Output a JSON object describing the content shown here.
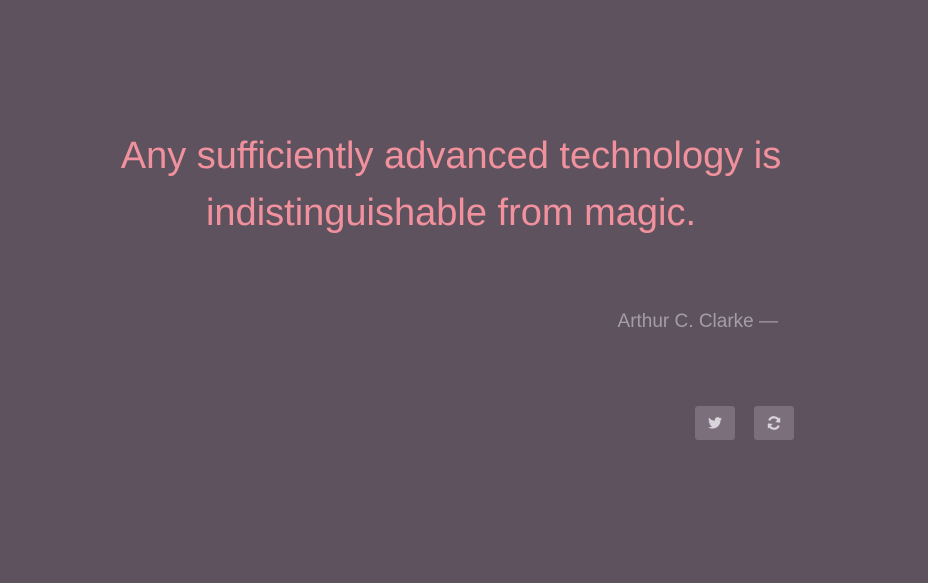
{
  "quote": {
    "text": "Any sufficiently advanced technology is indistinguishable from magic.",
    "author": "Arthur C. Clarke —"
  },
  "actions": {
    "tweet_icon": "twitter-icon",
    "new_quote_icon": "refresh-icon"
  },
  "colors": {
    "background": "#5d525d",
    "quote_text": "#f1919e",
    "author_text": "#a59ca6",
    "button_bg": "#7a6f7b",
    "icon": "#d9d3da"
  }
}
